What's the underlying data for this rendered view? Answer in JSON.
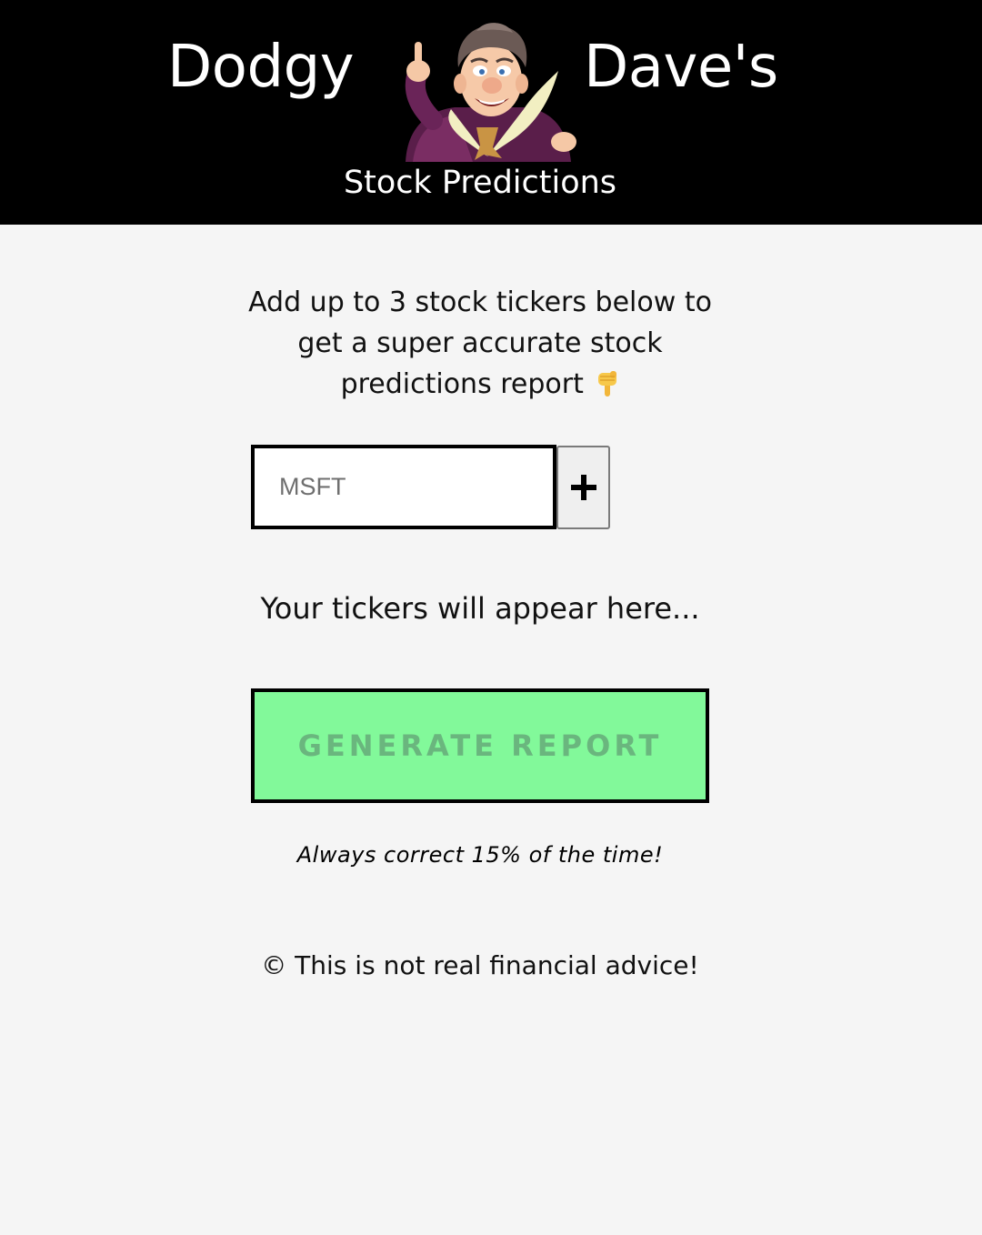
{
  "header": {
    "brand_left": "Dodgy",
    "brand_right": "Dave's",
    "subtitle": "Stock Predictions",
    "mascot_icon": "dodgy-dave-mascot-icon",
    "background": "#000000"
  },
  "main": {
    "intro_text": "Add up to 3 stock tickers below to get a super accurate stock predictions report",
    "intro_icon": "pointing-down-hand-icon",
    "ticker_input": {
      "placeholder": "MSFT",
      "value": ""
    },
    "add_button_icon": "plus-icon",
    "tickers_placeholder": "Your tickers will appear here...",
    "generate_button_label": "GENERATE REPORT",
    "generate_button_color": "#82f99a",
    "tagline": "Always correct 15% of the time!"
  },
  "footer": {
    "text": "© This is not real financial advice!"
  }
}
